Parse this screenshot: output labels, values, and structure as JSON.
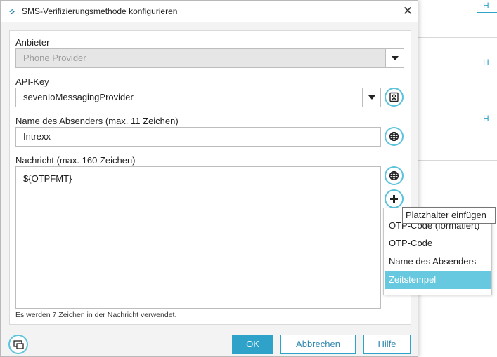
{
  "window": {
    "title": "SMS-Verifizierungsmethode konfigurieren",
    "close_glyph": "✕"
  },
  "form": {
    "provider": {
      "label": "Anbieter",
      "value": "Phone Provider"
    },
    "api_key": {
      "label": "API-Key",
      "value": "sevenIoMessagingProvider"
    },
    "sender": {
      "label": "Name des Absenders (max. 11 Zeichen)",
      "value": "Intrexx"
    },
    "message": {
      "label": "Nachricht (max. 160 Zeichen)",
      "value": "${OTPFMT}",
      "hint": "Es werden 7 Zeichen in der Nachricht verwendet."
    }
  },
  "tooltip": {
    "text": "Platzhalter einfügen"
  },
  "placeholder_menu": {
    "items": [
      "OTP-Code (formatiert)",
      "OTP-Code",
      "Name des Absenders",
      "Zeitstempel"
    ],
    "selected": "Zeitstempel"
  },
  "footer": {
    "ok_label": "OK",
    "cancel_label": "Abbrechen",
    "help_label": "Hilfe"
  },
  "background": {
    "button_label": "H"
  },
  "icons": {
    "app": "app-logo-icon",
    "dropdown": "chevron-down-icon",
    "key": "key-icon",
    "globe": "globe-icon",
    "plus": "plus-icon",
    "footer": "screen-icon"
  },
  "colors": {
    "accent": "#2ea2c9",
    "selection": "#67c9df",
    "icon_ring": "#5bc3dc"
  }
}
